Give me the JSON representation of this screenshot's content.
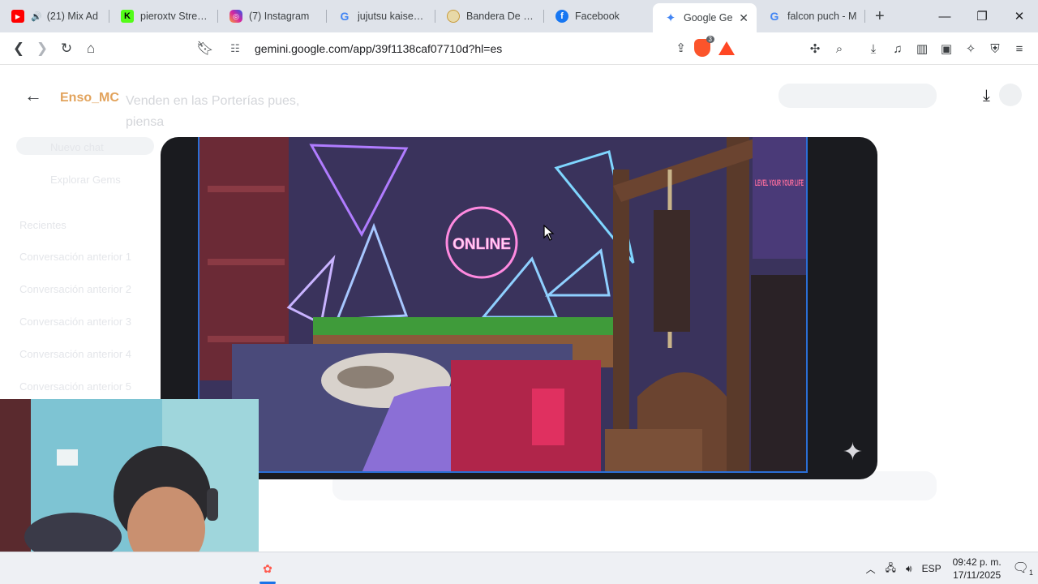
{
  "tabs": [
    {
      "title": "(21) Mix Ad",
      "icon": "youtube-icon",
      "color": "#ff0000",
      "audio": true
    },
    {
      "title": "pieroxtv Stream",
      "icon": "kick-icon",
      "color": "#53fc18"
    },
    {
      "title": "(7) Instagram",
      "icon": "instagram-icon",
      "color": "#d6249f"
    },
    {
      "title": "jujutsu kaisen p",
      "icon": "google-icon",
      "color": "#4285f4"
    },
    {
      "title": "Bandera De Juj",
      "icon": "flag-icon",
      "color": "#c89b3c"
    },
    {
      "title": "Facebook",
      "icon": "facebook-icon",
      "color": "#1877f2"
    },
    {
      "title": "Google Ge",
      "icon": "gemini-icon",
      "color": "#4285f4",
      "active": true
    },
    {
      "title": "falcon puch - M",
      "icon": "google-icon",
      "color": "#4285f4"
    }
  ],
  "toolbar": {
    "url": "gemini.google.com/app/39f1138caf07710d?hl=es",
    "brave_badge": "3"
  },
  "page": {
    "chat_name": "Enso_MC",
    "chat_message": "Venden en las Porterías pues, piensa",
    "ghost_items": [
      "Nuevo chat",
      "Explorar Gems",
      "Recientes",
      "Conversación anterior 1",
      "Conversación anterior 2",
      "Conversación anterior 3",
      "Conversación anterior 4",
      "Conversación anterior 5"
    ]
  },
  "photo": {
    "sign_text": "ONLINE",
    "poster_text": "LEVEL YOUR YOUR LIFE"
  },
  "taskbar": {
    "language": "ESP",
    "time": "09:42 p. m.",
    "date": "17/11/2025",
    "notification_count": "1"
  },
  "colors": {
    "accent_blue": "#1a73e8",
    "neon_pink": "#ff7ad9",
    "neon_blue": "#7fd6ff"
  }
}
